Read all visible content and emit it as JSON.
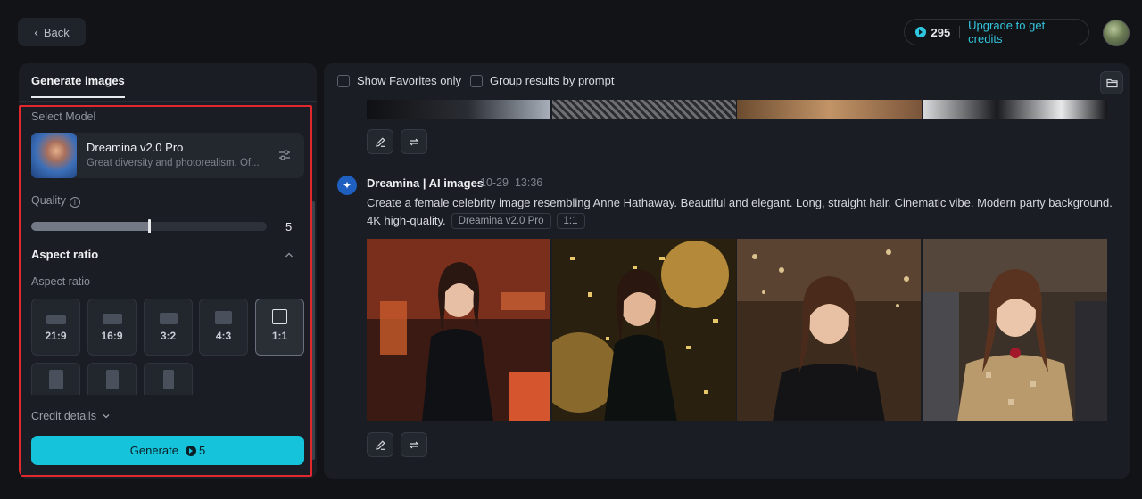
{
  "topbar": {
    "back_label": "Back",
    "credits": "295",
    "upgrade_label": "Upgrade to get credits"
  },
  "left_panel": {
    "tab_label": "Generate images",
    "select_model_label": "Select Model",
    "model": {
      "name": "Dreamina v2.0 Pro",
      "description": "Great diversity and photorealism. Of..."
    },
    "quality": {
      "label": "Quality",
      "value": "5",
      "level_fraction": 0.5
    },
    "aspect_ratio_header": "Aspect ratio",
    "aspect_ratio_label": "Aspect ratio",
    "aspect_ratios": [
      "21:9",
      "16:9",
      "3:2",
      "4:3",
      "1:1"
    ],
    "selected_ratio": "1:1",
    "credit_details_label": "Credit details",
    "generate_label": "Generate",
    "generate_cost": "5"
  },
  "results": {
    "show_favorites_label": "Show Favorites only",
    "group_by_prompt_label": "Group results by prompt",
    "bot_name": "Dreamina | AI images",
    "date": "10-29",
    "time": "13:36",
    "prompt": "Create a female celebrity image resembling Anne Hathaway. Beautiful and elegant. Long, straight hair. Cinematic vibe. Modern party background. 4K high-quality.",
    "tag_model": "Dreamina v2.0 Pro",
    "tag_ratio": "1:1"
  },
  "colors": {
    "accent": "#15c4da",
    "highlight_border": "#e0282e",
    "panel_bg": "#1a1d23",
    "page_bg": "#111317"
  }
}
